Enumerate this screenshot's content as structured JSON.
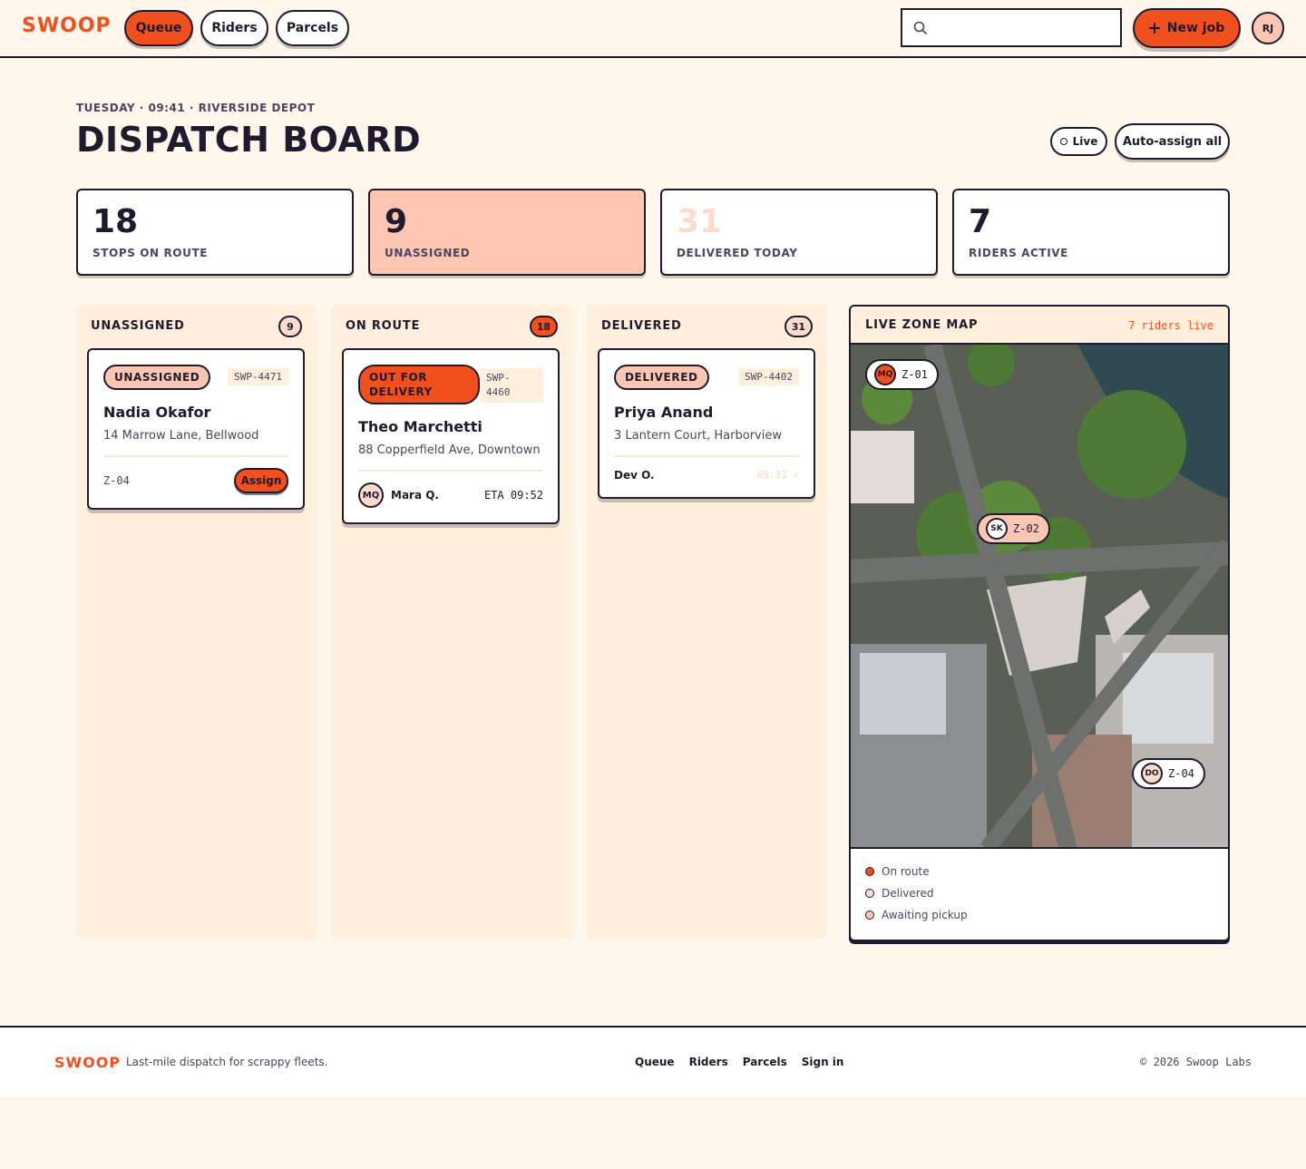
{
  "header": {
    "logo": "SWOOP",
    "nav": [
      "Queue",
      "Riders",
      "Parcels"
    ],
    "search_placeholder": "",
    "new_job_label": "New job",
    "user_initials": "RJ"
  },
  "page": {
    "eyebrow": "TUESDAY · 09:41 · RIVERSIDE DEPOT",
    "title": "DISPATCH BOARD",
    "live_label": "Live",
    "auto_assign_label": "Auto-assign all"
  },
  "stats": [
    {
      "value": "18",
      "label": "STOPS ON ROUTE"
    },
    {
      "value": "9",
      "label": "UNASSIGNED"
    },
    {
      "value": "31",
      "label": "DELIVERED TODAY"
    },
    {
      "value": "7",
      "label": "RIDERS ACTIVE"
    }
  ],
  "columns": [
    {
      "title": "UNASSIGNED",
      "count": "9",
      "card": {
        "status": "UNASSIGNED",
        "ref": "SWP-4471",
        "name": "Nadia Okafor",
        "address": "14 Marrow Lane, Bellwood",
        "zone": "Z-04",
        "action": "Assign"
      }
    },
    {
      "title": "ON ROUTE",
      "count": "18",
      "card": {
        "status_line1": "OUT FOR",
        "status_line2": "DELIVERY",
        "ref_line1": "SWP-",
        "ref_line2": "4460",
        "name": "Theo Marchetti",
        "address": "88 Copperfield Ave, Downtown",
        "rider_initials": "MQ",
        "rider_name": "Mara Q.",
        "eta": "ETA 09:52"
      }
    },
    {
      "title": "DELIVERED",
      "count": "31",
      "card": {
        "status": "DELIVERED",
        "ref": "SWP-4402",
        "name": "Priya Anand",
        "address": "3 Lantern Court, Harborview",
        "rider_name": "Dev O.",
        "time": "09:31 ✓"
      }
    }
  ],
  "map": {
    "title": "LIVE ZONE MAP",
    "riders_live": "7 riders live",
    "pins": [
      {
        "initials": "MQ",
        "zone": "Z-01"
      },
      {
        "initials": "SK",
        "zone": "Z-02"
      },
      {
        "initials": "DO",
        "zone": "Z-04"
      }
    ],
    "legend": [
      {
        "label": "On route",
        "color": "#f24f1e"
      },
      {
        "label": "Delivered",
        "color": "#fcdccd"
      },
      {
        "label": "Awaiting pickup",
        "color": "#fcc6b3"
      }
    ]
  },
  "footer": {
    "logo": "SWOOP",
    "tagline": "Last-mile dispatch for scrappy fleets.",
    "links": [
      "Queue",
      "Riders",
      "Parcels",
      "Sign in"
    ],
    "copyright": "© 2026 Swoop Labs"
  },
  "colors": {
    "accent": "#f24f1e",
    "ink": "#1f1a2e",
    "peach": "#fcc6b3",
    "cream": "#fff6ec"
  }
}
